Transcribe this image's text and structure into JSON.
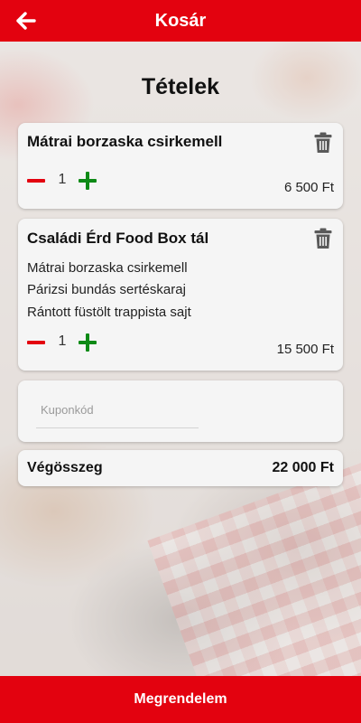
{
  "header": {
    "title": "Kosár",
    "back_icon": "arrow-left-icon"
  },
  "main": {
    "heading": "Tételek",
    "items": [
      {
        "name": "Mátrai borzaska csirkemell",
        "quantity": "1",
        "price": "6 500 Ft",
        "sub_items": []
      },
      {
        "name": "Családi Érd Food Box tál",
        "quantity": "1",
        "price": "15 500 Ft",
        "sub_items": [
          "Mátrai borzaska csirkemell",
          "Párizsi bundás sertéskaraj",
          "Rántott füstölt trappista sajt"
        ]
      }
    ],
    "coupon": {
      "placeholder": "Kuponkód",
      "value": ""
    },
    "total": {
      "label": "Végösszeg",
      "value": "22 000 Ft"
    }
  },
  "footer": {
    "order_label": "Megrendelem"
  },
  "colors": {
    "brand_red": "#e3020f",
    "minus_red": "#e3020f",
    "plus_green": "#0e8a16",
    "trash_gray": "#5a5a5a"
  }
}
